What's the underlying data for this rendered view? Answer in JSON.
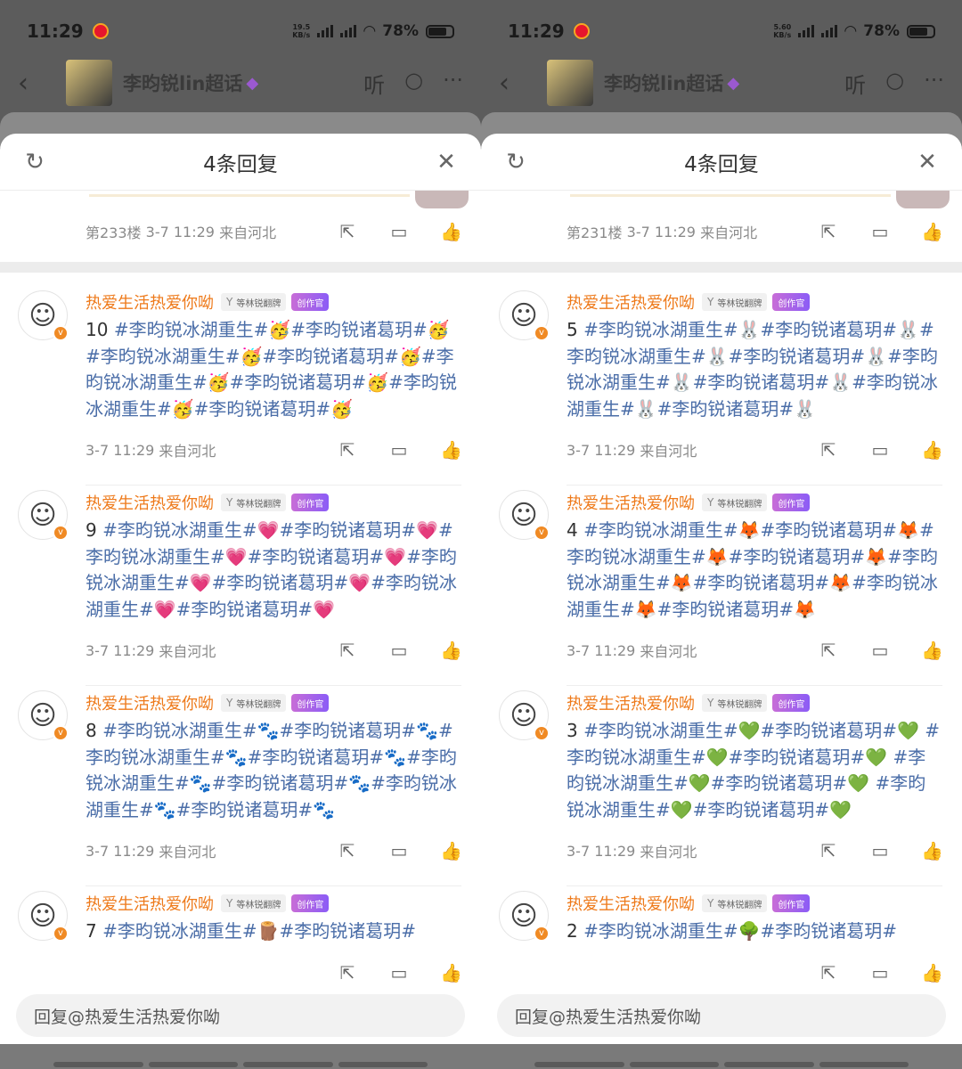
{
  "panels": [
    {
      "status": {
        "time": "11:29",
        "speed_top": "19.5",
        "speed_unit": "KB/s",
        "net": "5G",
        "battery": "78%"
      },
      "header": {
        "title": "李昀锐lin超话"
      },
      "sheet": {
        "title": "4条回复"
      },
      "top_comment": {
        "floor": "第233楼",
        "time": "3-7 11:29",
        "location": "来自河北"
      },
      "replies": [
        {
          "user": "热爱生活热爱你呦",
          "fan_badge": "等林锐翻牌",
          "creator_badge": "创作官",
          "text": "10 #李昀锐冰湖重生#🥳#李昀锐诸葛玥#🥳#李昀锐冰湖重生#🥳#李昀锐诸葛玥#🥳#李昀锐冰湖重生#🥳#李昀锐诸葛玥#🥳#李昀锐冰湖重生#🥳#李昀锐诸葛玥#🥳",
          "time": "3-7 11:29",
          "location": "来自河北"
        },
        {
          "user": "热爱生活热爱你呦",
          "fan_badge": "等林锐翻牌",
          "creator_badge": "创作官",
          "text": "9 #李昀锐冰湖重生#💗#李昀锐诸葛玥#💗#李昀锐冰湖重生#💗#李昀锐诸葛玥#💗#李昀锐冰湖重生#💗#李昀锐诸葛玥#💗#李昀锐冰湖重生#💗#李昀锐诸葛玥#💗",
          "time": "3-7 11:29",
          "location": "来自河北"
        },
        {
          "user": "热爱生活热爱你呦",
          "fan_badge": "等林锐翻牌",
          "creator_badge": "创作官",
          "text": "8 #李昀锐冰湖重生#🐾#李昀锐诸葛玥#🐾#李昀锐冰湖重生#🐾#李昀锐诸葛玥#🐾#李昀锐冰湖重生#🐾#李昀锐诸葛玥#🐾#李昀锐冰湖重生#🐾#李昀锐诸葛玥#🐾",
          "time": "3-7 11:29",
          "location": "来自河北"
        },
        {
          "user": "热爱生活热爱你呦",
          "fan_badge": "等林锐翻牌",
          "creator_badge": "创作官",
          "text": "7 #李昀锐冰湖重生#🪵#李昀锐诸葛玥#",
          "time": "",
          "location": ""
        }
      ],
      "reply_placeholder": "回复@热爱生活热爱你呦"
    },
    {
      "status": {
        "time": "11:29",
        "speed_top": "5.60",
        "speed_unit": "KB/s",
        "net": "5G",
        "battery": "78%"
      },
      "header": {
        "title": "李昀锐lin超话"
      },
      "sheet": {
        "title": "4条回复"
      },
      "top_comment": {
        "floor": "第231楼",
        "time": "3-7 11:29",
        "location": "来自河北"
      },
      "replies": [
        {
          "user": "热爱生活热爱你呦",
          "fan_badge": "等林锐翻牌",
          "creator_badge": "创作官",
          "text": "5 #李昀锐冰湖重生#🐰#李昀锐诸葛玥#🐰#李昀锐冰湖重生#🐰#李昀锐诸葛玥#🐰#李昀锐冰湖重生#🐰#李昀锐诸葛玥#🐰#李昀锐冰湖重生#🐰#李昀锐诸葛玥#🐰",
          "time": "3-7 11:29",
          "location": "来自河北"
        },
        {
          "user": "热爱生活热爱你呦",
          "fan_badge": "等林锐翻牌",
          "creator_badge": "创作官",
          "text": "4 #李昀锐冰湖重生#🦊#李昀锐诸葛玥#🦊#李昀锐冰湖重生#🦊#李昀锐诸葛玥#🦊#李昀锐冰湖重生#🦊#李昀锐诸葛玥#🦊#李昀锐冰湖重生#🦊#李昀锐诸葛玥#🦊",
          "time": "3-7 11:29",
          "location": "来自河北"
        },
        {
          "user": "热爱生活热爱你呦",
          "fan_badge": "等林锐翻牌",
          "creator_badge": "创作官",
          "text": "3 #李昀锐冰湖重生#💚#李昀锐诸葛玥#💚 #李昀锐冰湖重生#💚#李昀锐诸葛玥#💚 #李昀锐冰湖重生#💚#李昀锐诸葛玥#💚 #李昀锐冰湖重生#💚#李昀锐诸葛玥#💚",
          "time": "3-7 11:29",
          "location": "来自河北"
        },
        {
          "user": "热爱生活热爱你呦",
          "fan_badge": "等林锐翻牌",
          "creator_badge": "创作官",
          "text": "2 #李昀锐冰湖重生#🌳#李昀锐诸葛玥#",
          "time": "",
          "location": ""
        }
      ],
      "reply_placeholder": "回复@热爱生活热爱你呦"
    }
  ],
  "icons": {
    "back": "back-arrow-icon",
    "listen": "headphones-icon",
    "search": "search-icon",
    "more": "more-icon",
    "refresh": "refresh-icon",
    "close": "close-icon",
    "share": "share-icon",
    "comment": "comment-icon",
    "like": "like-icon"
  },
  "colors": {
    "username": "#ee7a1b",
    "hashtag": "#4b6ea8",
    "creator_badge": "#a66ad9"
  },
  "labels": {
    "listen": "听"
  }
}
